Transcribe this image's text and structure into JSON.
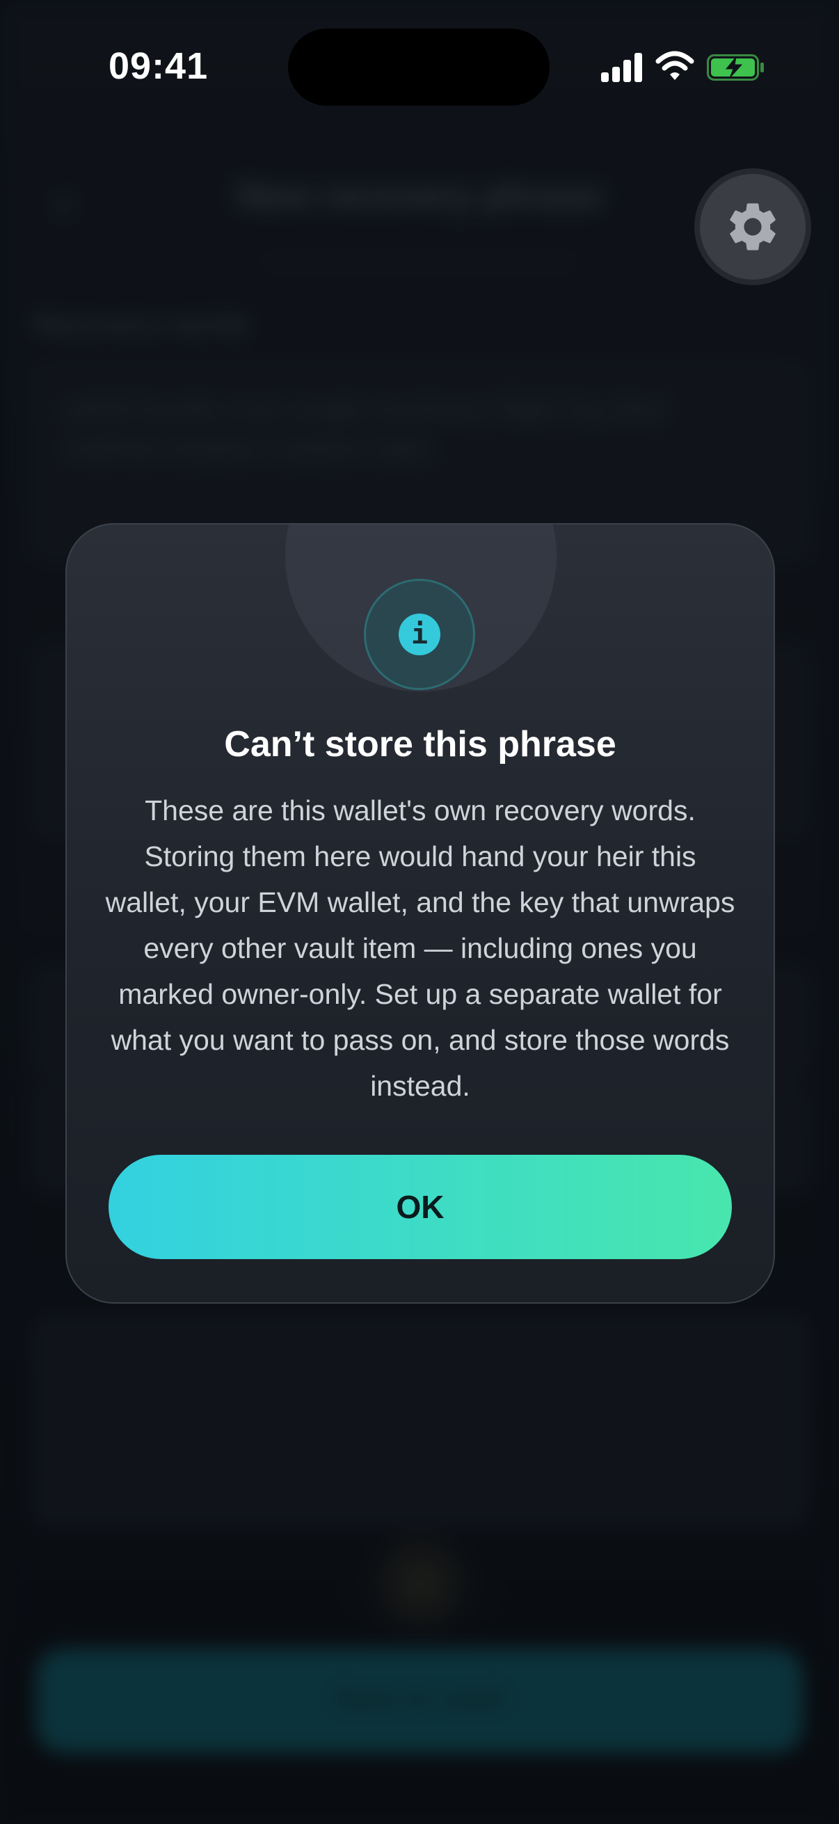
{
  "status_bar": {
    "time": "09:41"
  },
  "background": {
    "back_icon": "chevron-left-icon",
    "title": "New recovery phrase",
    "section_label": "Recovery words",
    "words_text": "admit border river single mechanic flight fog deer method shadow outdoor topic",
    "cta_label": "Save to vault"
  },
  "gear": {
    "icon": "gear-icon"
  },
  "modal": {
    "icon": "info-icon",
    "title": "Can’t store this phrase",
    "body": "These are this wallet's own recovery words. Storing them here would hand your heir this wallet, your EVM wallet, and the key that unwraps every other vault item — including ones you marked owner-only. Set up a separate wallet for what you want to pass on, and store those words instead.",
    "ok_label": "OK",
    "accent_start": "#33d1e0",
    "accent_end": "#48e6ad"
  }
}
